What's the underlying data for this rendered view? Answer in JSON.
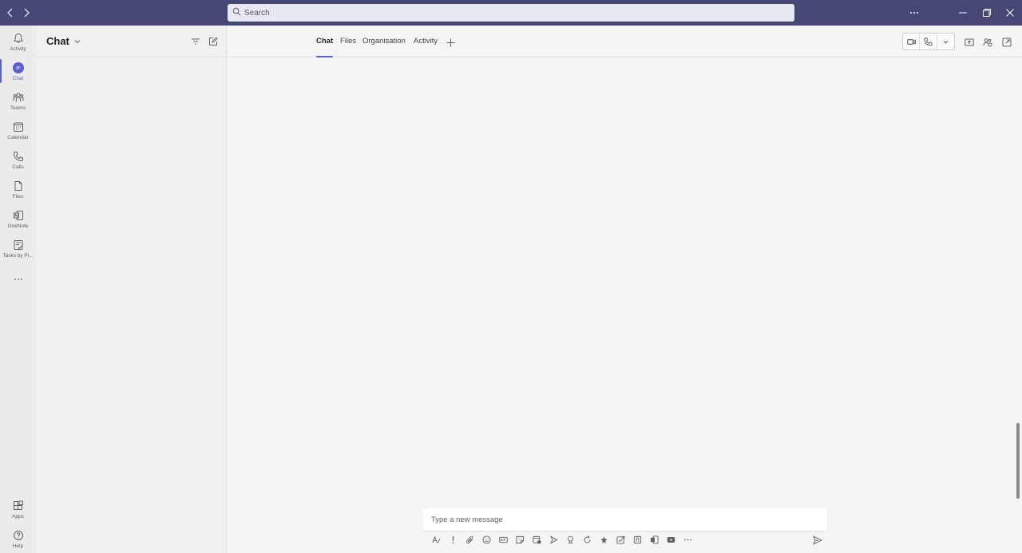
{
  "titlebar": {
    "search_placeholder": "Search",
    "more_label": "More options",
    "window_controls": [
      "minimize",
      "restore",
      "close"
    ]
  },
  "rail": {
    "items": [
      {
        "label": "Activity",
        "icon": "bell-icon"
      },
      {
        "label": "Chat",
        "icon": "chat-icon"
      },
      {
        "label": "Teams",
        "icon": "teams-icon"
      },
      {
        "label": "Calendar",
        "icon": "calendar-icon"
      },
      {
        "label": "Calls",
        "icon": "phone-icon"
      },
      {
        "label": "Files",
        "icon": "file-icon"
      },
      {
        "label": "OneNote",
        "icon": "onenote-icon"
      },
      {
        "label": "Tasks by Pl...",
        "icon": "tasks-icon"
      }
    ],
    "more": "...",
    "bottom": [
      {
        "label": "Apps",
        "icon": "apps-icon"
      },
      {
        "label": "Help",
        "icon": "help-icon"
      }
    ]
  },
  "chatlist": {
    "title": "Chat"
  },
  "main": {
    "tabs": [
      {
        "label": "Chat",
        "active": true
      },
      {
        "label": "Files",
        "active": false
      },
      {
        "label": "Organisation",
        "active": false
      },
      {
        "label": "Activity",
        "active": false
      }
    ]
  },
  "composer": {
    "placeholder": "Type a new message"
  },
  "colors": {
    "titlebar": "#464775",
    "accent": "#5b5fc7"
  }
}
